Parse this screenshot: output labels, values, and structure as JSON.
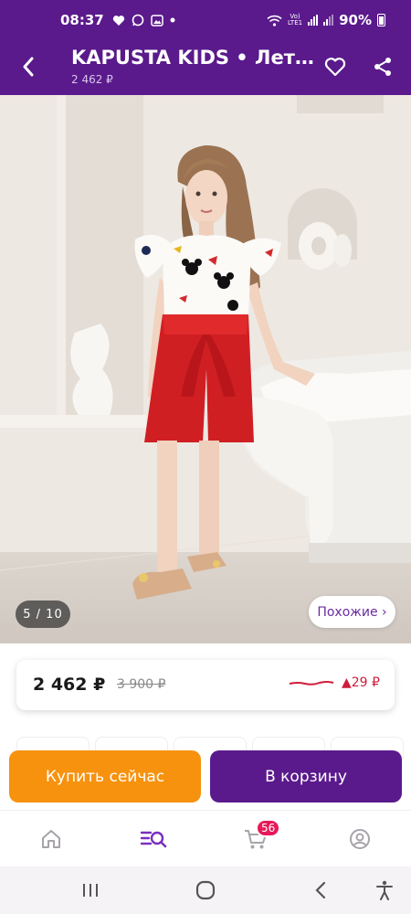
{
  "status_bar": {
    "time": "08:37",
    "battery": "90%",
    "net_label": "LTE1",
    "icons": [
      "heart-icon",
      "whatsapp-icon",
      "gallery-icon",
      "dot-icon",
      "wifi-icon",
      "volte-icon",
      "signal-icon",
      "battery-icon"
    ]
  },
  "header": {
    "title": "KAPUSTA KIDS • Летний костюм",
    "subtitle": "2 462 ₽"
  },
  "gallery": {
    "counter": "5 / 10",
    "similar_label": "Похожие ›",
    "current": 5,
    "total": 10
  },
  "price": {
    "current": "2 462 ₽",
    "old": "3 900 ₽",
    "delta": "▲29 ₽",
    "trend_color": "#d01c3a"
  },
  "actions": {
    "buy_now": "Купить сейчас",
    "add_to_cart": "В корзину"
  },
  "bottom_nav": {
    "cart_badge": "56",
    "items": [
      "home-icon",
      "catalog-search-icon",
      "cart-icon",
      "profile-icon"
    ]
  },
  "colors": {
    "brand": "#5a1a8c",
    "buy": "#f7920e",
    "badge": "#e6195a"
  }
}
